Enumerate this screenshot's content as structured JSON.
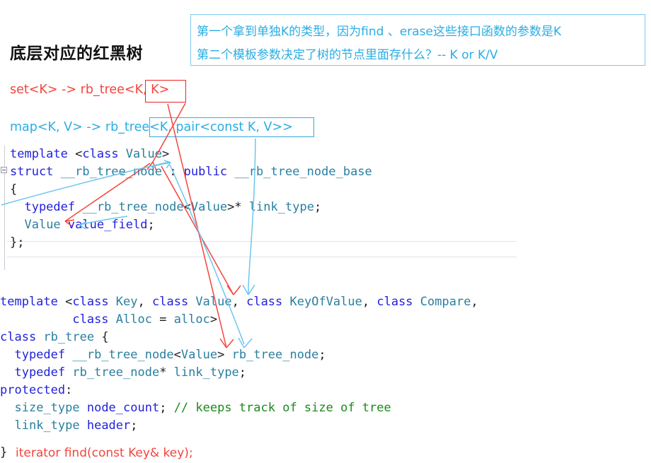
{
  "header": {
    "title": "底层对应的红黑树",
    "note": {
      "line1": "第一个拿到单独K的类型，因为find 、erase这些接口函数的参数是K",
      "line2": "第二个模板参数决定了树的节点里面存什么？-- K or K/V",
      "color": "#29ade4",
      "border_color": "#7ec8ef"
    }
  },
  "mappings": {
    "set_line": "set<K> -> rb_tree<K, K>",
    "set_color": "#f4443c",
    "set_highlight": "K, K",
    "map_line": "map<K, V> -> rb_tree<K, pair<const K, V>>",
    "map_color": "#29ade4",
    "map_highlight": "K, pair<const K, V>"
  },
  "code_block_node": {
    "lines": [
      [
        {
          "t": "template ",
          "c": "kw"
        },
        {
          "t": "<",
          "c": "pl"
        },
        {
          "t": "class ",
          "c": "kw"
        },
        {
          "t": "Value",
          "c": "ty"
        },
        {
          "t": ">",
          "c": "pl"
        }
      ],
      [
        {
          "t": "struct ",
          "c": "kw"
        },
        {
          "t": "__rb_tree_node",
          "c": "ty"
        },
        {
          "t": " : ",
          "c": "pl"
        },
        {
          "t": "public ",
          "c": "kw"
        },
        {
          "t": "__rb_tree_node_base",
          "c": "ty"
        }
      ],
      [
        {
          "t": "{",
          "c": "pl"
        }
      ],
      [
        {
          "t": "  typedef ",
          "c": "kw"
        },
        {
          "t": "__rb_tree_node",
          "c": "ty"
        },
        {
          "t": "<",
          "c": "pl"
        },
        {
          "t": "Value",
          "c": "ty"
        },
        {
          "t": ">* ",
          "c": "pl"
        },
        {
          "t": "link_type",
          "c": "ty"
        },
        {
          "t": ";",
          "c": "pl"
        }
      ],
      [
        {
          "t": "  ",
          "c": "pl"
        },
        {
          "t": "Value ",
          "c": "ty"
        },
        {
          "t": "value_field",
          "c": "kw"
        },
        {
          "t": ";",
          "c": "pl"
        }
      ],
      [
        {
          "t": "};",
          "c": "pl"
        }
      ]
    ]
  },
  "code_block_tree": {
    "lines": [
      [
        {
          "t": "template ",
          "c": "kw"
        },
        {
          "t": "<",
          "c": "pl"
        },
        {
          "t": "class ",
          "c": "kw"
        },
        {
          "t": "Key",
          "c": "ty"
        },
        {
          "t": ", ",
          "c": "pl"
        },
        {
          "t": "class ",
          "c": "kw"
        },
        {
          "t": "Value",
          "c": "ty"
        },
        {
          "t": ", ",
          "c": "pl"
        },
        {
          "t": "class ",
          "c": "kw"
        },
        {
          "t": "KeyOfValue",
          "c": "ty"
        },
        {
          "t": ", ",
          "c": "pl"
        },
        {
          "t": "class ",
          "c": "kw"
        },
        {
          "t": "Compare",
          "c": "ty"
        },
        {
          "t": ",",
          "c": "pl"
        }
      ],
      [
        {
          "t": "          ",
          "c": "pl"
        },
        {
          "t": "class ",
          "c": "kw"
        },
        {
          "t": "Alloc",
          "c": "ty"
        },
        {
          "t": " = ",
          "c": "pl"
        },
        {
          "t": "alloc",
          "c": "ty"
        },
        {
          "t": ">",
          "c": "pl"
        }
      ],
      [
        {
          "t": "class ",
          "c": "kw"
        },
        {
          "t": "rb_tree",
          "c": "ty"
        },
        {
          "t": " {",
          "c": "pl"
        }
      ],
      [
        {
          "t": "  typedef ",
          "c": "kw"
        },
        {
          "t": "__rb_tree_node",
          "c": "ty"
        },
        {
          "t": "<",
          "c": "pl"
        },
        {
          "t": "Value",
          "c": "ty"
        },
        {
          "t": "> ",
          "c": "pl"
        },
        {
          "t": "rb_tree_node",
          "c": "ty"
        },
        {
          "t": ";",
          "c": "pl"
        }
      ],
      [
        {
          "t": "  typedef ",
          "c": "kw"
        },
        {
          "t": "rb_tree_node",
          "c": "ty"
        },
        {
          "t": "* ",
          "c": "pl"
        },
        {
          "t": "link_type",
          "c": "ty"
        },
        {
          "t": ";",
          "c": "pl"
        }
      ],
      [
        {
          "t": "protected",
          "c": "kw"
        },
        {
          "t": ":",
          "c": "pl"
        }
      ],
      [
        {
          "t": "  ",
          "c": "pl"
        },
        {
          "t": "size_type ",
          "c": "ty"
        },
        {
          "t": "node_count",
          "c": "kw"
        },
        {
          "t": "; ",
          "c": "pl"
        },
        {
          "t": "// keeps track of size of tree",
          "c": "cm"
        }
      ],
      [
        {
          "t": "  ",
          "c": "pl"
        },
        {
          "t": "link_type ",
          "c": "ty"
        },
        {
          "t": "header",
          "c": "kw"
        },
        {
          "t": ";",
          "c": "pl"
        }
      ]
    ]
  },
  "footer": {
    "brace": "}",
    "signature": "iterator find(const Key& key);",
    "signature_color": "#f4443c"
  },
  "annotations": {
    "red_color": "#f4443c",
    "blue_color": "#6cc6ef"
  }
}
